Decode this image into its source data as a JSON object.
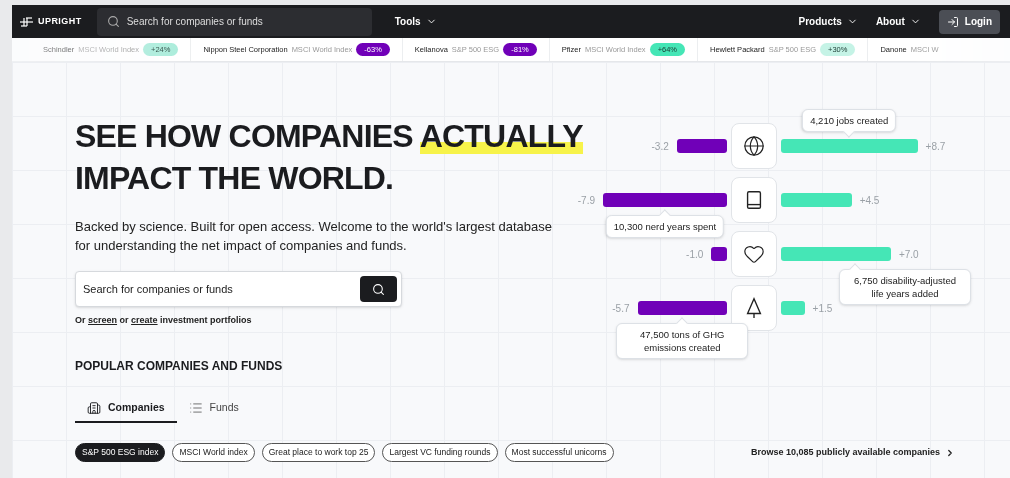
{
  "nav": {
    "logo": "UPRIGHT",
    "search_placeholder": "Search for companies or funds",
    "tools_menu": "Tools",
    "menus": [
      "Products",
      "About"
    ],
    "login": "Login"
  },
  "ticker": [
    {
      "company": "Schindler",
      "index": "MSCI World Index",
      "change": "+24%",
      "color": "#a6ebd9"
    },
    {
      "company": "Nippon Steel Corporation",
      "index": "MSCI World Index",
      "change": "-63%",
      "color": "#7000b8"
    },
    {
      "company": "Kellanova",
      "index": "S&P 500 ESG",
      "change": "-81%",
      "color": "#7000b8"
    },
    {
      "company": "Pfizer",
      "index": "MSCI World Index",
      "change": "+64%",
      "color": "#45e6b6"
    },
    {
      "company": "Hewlett Packard",
      "index": "S&P 500 ESG",
      "change": "+30%",
      "color": "#c5f3e6"
    },
    {
      "company": "Danone",
      "index": "MSCI W"
    }
  ],
  "hero": {
    "headline_before": "SEE HOW COMPANIES ",
    "headline_highlight": "ACTUALLY",
    "headline_after": "IMPACT THE WORLD.",
    "intro": "Backed by science. Built for open access. Welcome to the world's largest database for understanding the net impact of companies and funds.",
    "search_placeholder": "Search for companies or funds",
    "links": {
      "before": "Or ",
      "screen": "screen",
      "middle": " or ",
      "create": "create",
      "after": " investment portfolios"
    }
  },
  "impact_rows": [
    {
      "kind": "globe",
      "negative": {
        "reading": "-3.2"
      },
      "positive": {
        "reading": "+8.7",
        "callout": "4,210 jobs created"
      }
    },
    {
      "kind": "book",
      "negative": {
        "reading": "-7.9",
        "callout": "10,300 nerd years spent"
      },
      "positive": {
        "reading": "+4.5"
      }
    },
    {
      "kind": "heart",
      "negative": {
        "reading": "-1.0"
      },
      "positive": {
        "reading": "+7.0",
        "callout": "6,750 disability-adjusted life years added"
      }
    },
    {
      "kind": "tree",
      "negative": {
        "reading": "-5.7",
        "callout": "47,500 tons of GHG emissions created"
      },
      "positive": {
        "reading": "+1.5"
      }
    }
  ],
  "popular": {
    "title": "POPULAR COMPANIES AND FUNDS",
    "tabs": [
      {
        "label": "Companies",
        "kind": "building",
        "selected": true
      },
      {
        "label": "Funds",
        "kind": "list",
        "selected": false
      }
    ],
    "chips": [
      {
        "label": "S&P 500 ESG index",
        "selected": true
      },
      {
        "label": "MSCI World index",
        "selected": false
      },
      {
        "label": "Great place to work top 25",
        "selected": false
      },
      {
        "label": "Largest VC funding rounds",
        "selected": false
      },
      {
        "label": "Most successful unicorns",
        "selected": false
      }
    ],
    "browse": "Browse 10,085 publicly available companies"
  }
}
